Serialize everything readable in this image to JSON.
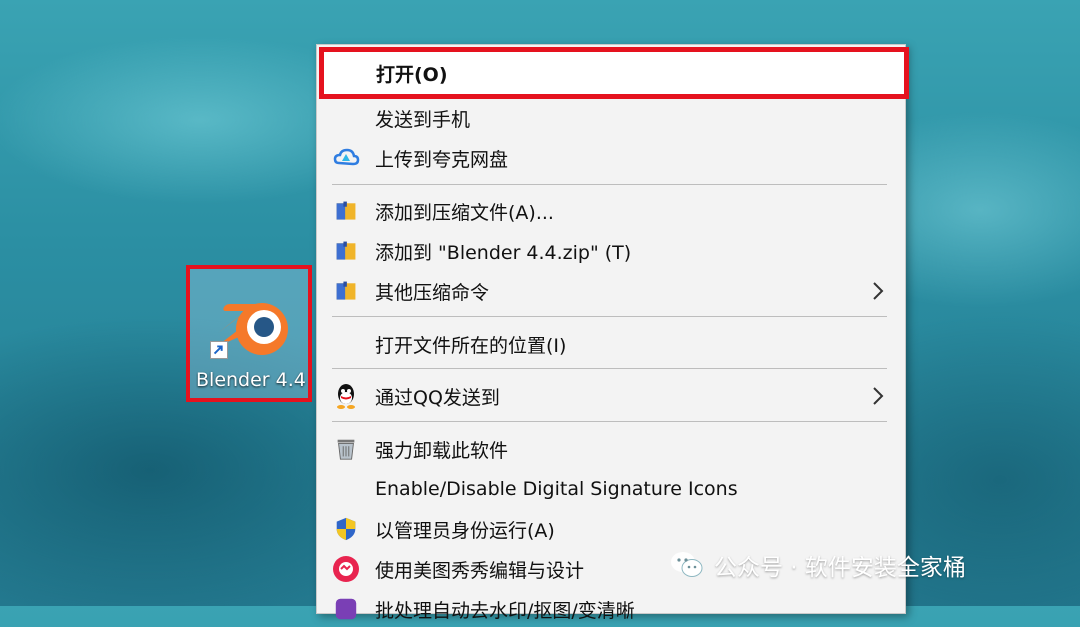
{
  "desktop": {
    "shortcut_label": "Blender 4.4",
    "watermark_text": "公众号 · 软件安装全家桶"
  },
  "context_menu": {
    "items": [
      {
        "label": "打开(O)",
        "icon": "none",
        "highlighted": true
      },
      {
        "label": "发送到手机",
        "icon": "none"
      },
      {
        "label": "上传到夸克网盘",
        "icon": "quark-cloud-icon"
      },
      {
        "label": "添加到压缩文件(A)...",
        "icon": "archive-icon"
      },
      {
        "label": "添加到 \"Blender 4.4.zip\" (T)",
        "icon": "archive-icon"
      },
      {
        "label": "其他压缩命令",
        "icon": "archive-icon",
        "submenu": true
      },
      {
        "label": "打开文件所在的位置(I)",
        "icon": "none"
      },
      {
        "label": "通过QQ发送到",
        "icon": "qq-penguin-icon",
        "submenu": true
      },
      {
        "label": "强力卸载此软件",
        "icon": "trash-bin-icon"
      },
      {
        "label": "Enable/Disable Digital Signature Icons",
        "icon": "none"
      },
      {
        "label": "以管理员身份运行(A)",
        "icon": "uac-shield-icon"
      },
      {
        "label": "使用美图秀秀编辑与设计",
        "icon": "meitu-icon"
      },
      {
        "label": "批处理自动去水印/抠图/变清晰",
        "icon": "meitu-batch-icon"
      }
    ]
  },
  "colors": {
    "highlight_border": "#e5121e",
    "menu_background": "#f3f3f3",
    "blender_orange": "#f5792a",
    "blender_blue": "#265787"
  }
}
